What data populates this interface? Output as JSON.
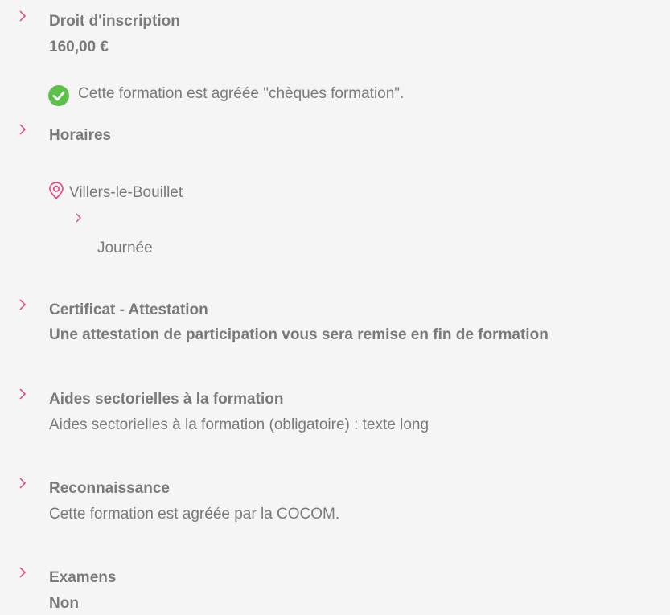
{
  "colors": {
    "text": "#7a7a7a",
    "accent": "#e6427a",
    "success": "#5cc04a",
    "background": "#f5f5f5"
  },
  "inscription": {
    "title": "Droit d'inscription",
    "price": "160,00 €",
    "badge_icon": "check-circle-icon",
    "badge_text": "Cette formation est agréée \"chèques formation\"."
  },
  "horaires": {
    "title": "Horaires",
    "location_icon": "map-pin-icon",
    "location": "Villers-le-Bouillet",
    "schedule": "Journée"
  },
  "certificat": {
    "title": "Certificat - Attestation",
    "text": "Une attestation de participation vous sera remise en fin de formation"
  },
  "aides": {
    "title": "Aides sectorielles à la formation",
    "text": "Aides sectorielles à la formation (obligatoire) : texte long"
  },
  "reconnaissance": {
    "title": "Reconnaissance",
    "text": "Cette formation est agréée par la COCOM."
  },
  "examens": {
    "title": "Examens",
    "text": "Non"
  }
}
